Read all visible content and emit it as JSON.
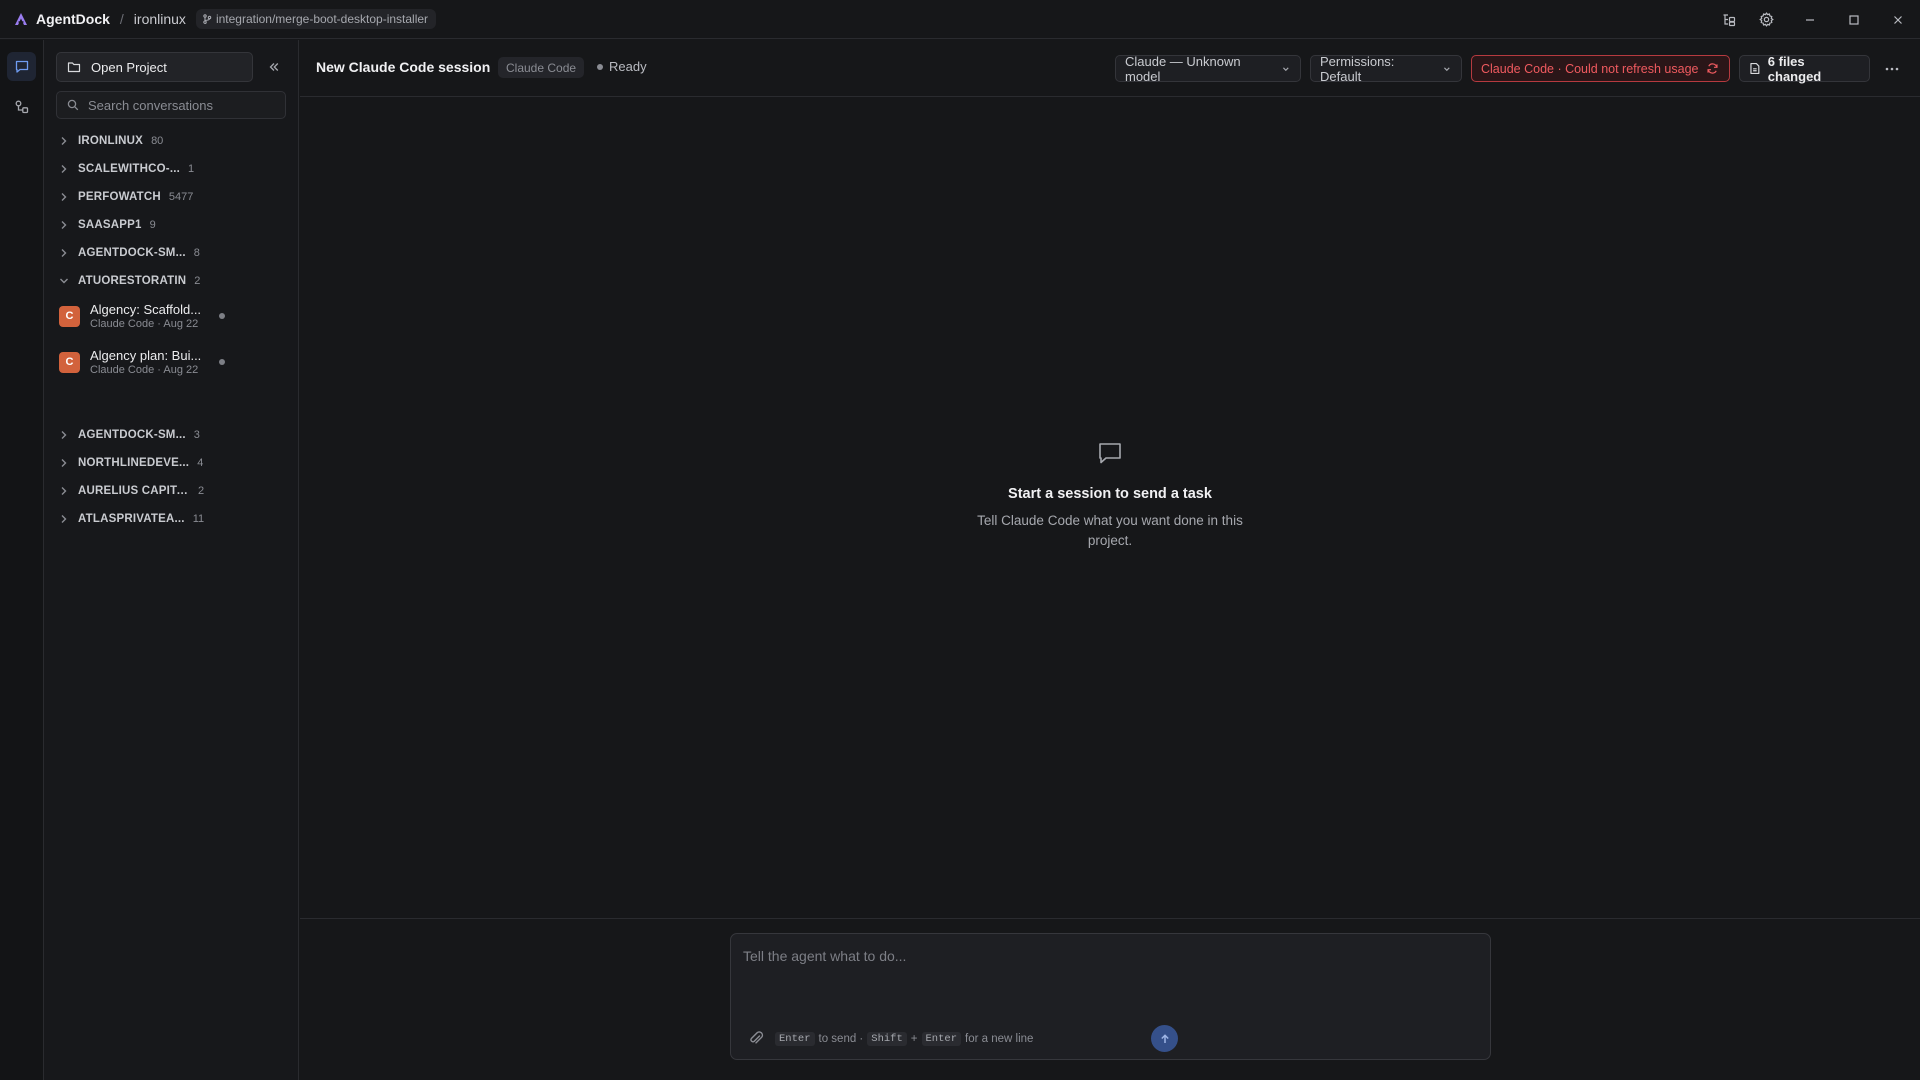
{
  "titlebar": {
    "app_name": "AgentDock",
    "separator": "/",
    "project": "ironlinux",
    "branch": "integration/merge-boot-desktop-installer"
  },
  "sidebar": {
    "open_project_label": "Open Project",
    "search_placeholder": "Search conversations",
    "groups": [
      {
        "name": "IRONLINUX",
        "count": "80",
        "expanded": false
      },
      {
        "name": "SCALEWITHCO-...",
        "count": "1",
        "expanded": false
      },
      {
        "name": "PERFOWATCH",
        "count": "5477",
        "expanded": false
      },
      {
        "name": "SAASAPP1",
        "count": "9",
        "expanded": false
      },
      {
        "name": "AGENTDOCK-SM...",
        "count": "8",
        "expanded": false
      },
      {
        "name": "ATUORESTORATIN",
        "count": "2",
        "expanded": true
      },
      {
        "name": "AGENTDOCK-SM...",
        "count": "3",
        "expanded": false
      },
      {
        "name": "NORTHLINEDEVE...",
        "count": "4",
        "expanded": false
      },
      {
        "name": "AURELIUS CAPITAL",
        "count": "2",
        "expanded": false
      },
      {
        "name": "ATLASPRIVATEA...",
        "count": "11",
        "expanded": false
      }
    ],
    "conversations": [
      {
        "avatar": "C",
        "title": "Algency: Scaffold...",
        "subtitle": "Claude Code · Aug 22"
      },
      {
        "avatar": "C",
        "title": "Algency plan: Bui...",
        "subtitle": "Claude Code · Aug 22"
      }
    ]
  },
  "header": {
    "session_title": "New Claude Code session",
    "agent_badge": "Claude Code",
    "status": "Ready",
    "model_selector": "Claude — Unknown model",
    "permissions_selector": "Permissions: Default",
    "usage_error": "Claude Code · Could not refresh usage",
    "files_changed": "6 files changed"
  },
  "empty_state": {
    "title": "Start a session to send a task",
    "description": "Tell Claude Code what you want done in this project."
  },
  "composer": {
    "placeholder": "Tell the agent what to do...",
    "key_enter": "Enter",
    "hint_send": "to send ·",
    "key_shift": "Shift",
    "plus": "+",
    "key_enter2": "Enter",
    "hint_newline": "for a new line"
  },
  "colors": {
    "accent": "#6f9cf2",
    "error": "#ef5a5f",
    "avatar": "#d2623c",
    "background": "#161719"
  }
}
